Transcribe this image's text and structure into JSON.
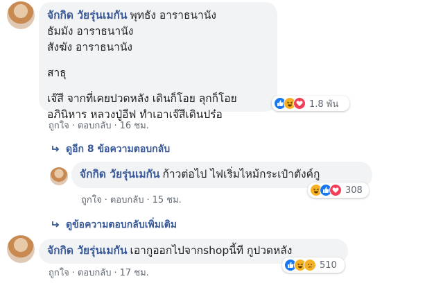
{
  "comment1": {
    "author": "จักกิด วัยรุ่นเมกัน",
    "lines": [
      "พุทธัง อาราธนานัง",
      "ธัมมัง อาราธนานัง",
      "สังฆัง อาราธนานัง",
      "",
      "สาธุ",
      "",
      "เจ๊สี จากที่เคยปวดหลัง เดินก็โอย ลุกก็โอย",
      "อภินิหาร หลวงปู่อีฟ ทำเอาเจ๊สีเดินปร๋อ"
    ],
    "reaction_count": "1.8 พัน",
    "reaction_icons": [
      "like-icon",
      "haha-icon",
      "love-icon"
    ],
    "like_label": "ถูกใจ",
    "reply_label": "ตอบกลับ",
    "time": "16 ชม."
  },
  "more_replies": "ดูอีก 8 ข้อความตอบกลับ",
  "reply1": {
    "author": "จักกิด วัยรุ่นเมกัน",
    "text": "ก้าวต่อไป ไฟเริ่มไหม้กระเป๋าตังค์กู",
    "reaction_count": "308",
    "reaction_icons": [
      "haha-icon",
      "like-icon",
      "love-icon"
    ],
    "like_label": "ถูกใจ",
    "reply_label": "ตอบกลับ",
    "time": "15 ชม."
  },
  "more_replies2": "ดูข้อความตอบกลับเพิ่มเติม",
  "comment2": {
    "author": "จักกิด วัยรุ่นเมกัน",
    "text": "เอากูออกไปจากshopนี้ที กูปวดหลัง",
    "reaction_count": "510",
    "reaction_icons": [
      "like-icon",
      "haha-icon",
      "sad-icon"
    ],
    "like_label": "ถูกใจ",
    "reply_label": "ตอบกลับ",
    "time": "17 ชม."
  },
  "dot": "·",
  "colors": {
    "link": "#385898",
    "bubble": "#f2f3f5",
    "meta": "#606770",
    "like": "#1877f2",
    "love": "#f33e58",
    "haha": "#f7b125"
  }
}
